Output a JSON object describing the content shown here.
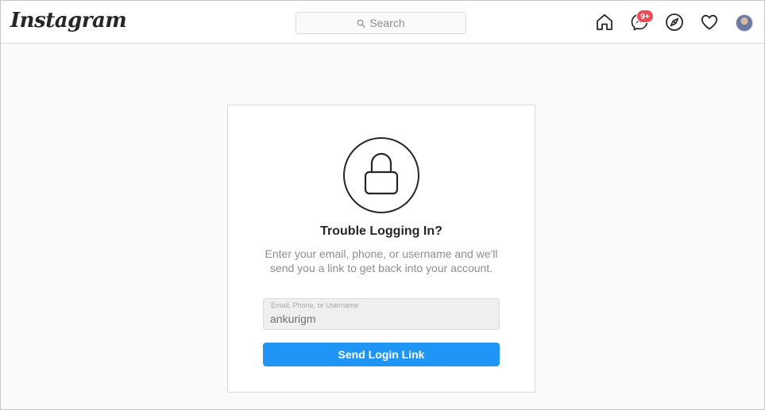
{
  "header": {
    "logo": "Instagram",
    "search": {
      "placeholder": "Search"
    },
    "nav": {
      "home_icon": "home-icon",
      "messenger_icon": "messenger-icon",
      "messenger_badge": "9+",
      "explore_icon": "compass-icon",
      "activity_icon": "heart-icon",
      "profile_icon": "avatar"
    }
  },
  "card": {
    "icon": "lock-icon",
    "title": "Trouble Logging In?",
    "description": "Enter your email, phone, or username and we'll send you a link to get back into your account.",
    "field": {
      "label": "Email, Phone, or Username",
      "value": "ankurigm"
    },
    "button_label": "Send Login Link"
  },
  "colors": {
    "accent": "#1f95f5",
    "badge": "#ed4956",
    "text": "#262626",
    "muted": "#8e8e8e",
    "border": "#dbdbdb",
    "background": "#fafafa"
  }
}
